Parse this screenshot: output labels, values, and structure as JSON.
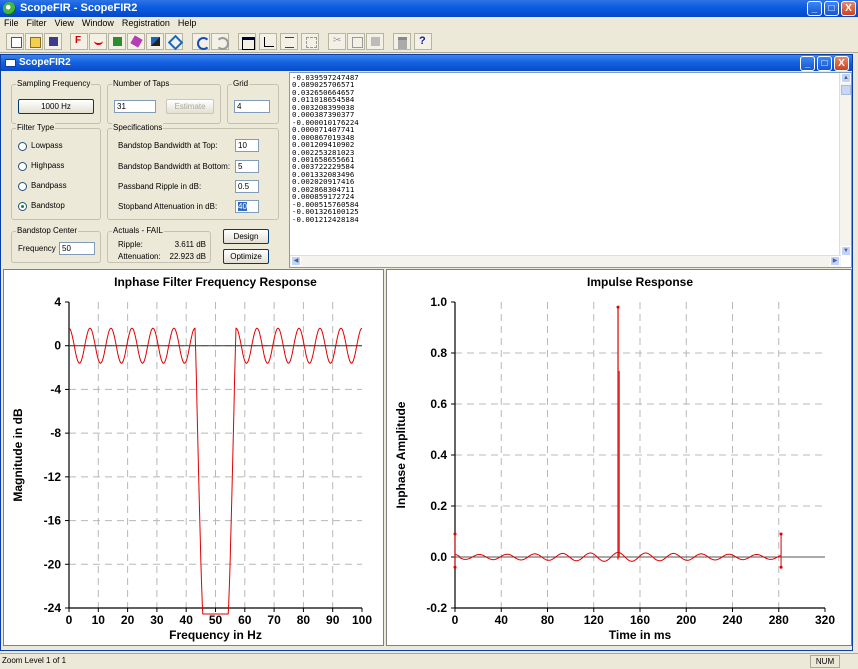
{
  "app": {
    "title": "ScopeFIR - ScopeFIR2",
    "window_buttons": {
      "minimize": "_",
      "maximize": "□",
      "close": "X"
    }
  },
  "menu": [
    "File",
    "Filter",
    "View",
    "Window",
    "Registration",
    "Help"
  ],
  "toolbar_icons": [
    "new-file-icon",
    "open-folder-icon",
    "save-icon",
    "filter-f-icon",
    "waveform-icon",
    "calculator-icon",
    "eraser-icon",
    "chart-icon",
    "diamond-icon",
    "undo-icon",
    "redo-icon",
    "window-icon",
    "axes-icon",
    "response-line-icon",
    "grid-icon",
    "cut-icon",
    "copy-icon",
    "paste-icon",
    "print-icon",
    "help-icon"
  ],
  "child_window": {
    "title": "ScopeFIR2"
  },
  "sampling_frequency": {
    "label": "Sampling Frequency",
    "button": "1000 Hz"
  },
  "number_of_taps": {
    "label": "Number of Taps",
    "value": "31",
    "estimate_button": "Estimate"
  },
  "grid": {
    "label": "Grid",
    "value": "4"
  },
  "filter_type": {
    "label": "Filter Type",
    "options": [
      "Lowpass",
      "Highpass",
      "Bandpass",
      "Bandstop"
    ],
    "selected": "Bandstop"
  },
  "specifications": {
    "label": "Specifications",
    "top_bw_label": "Bandstop Bandwidth at Top:",
    "top_bw": "10",
    "bottom_bw_label": "Bandstop Bandwidth at Bottom:",
    "bottom_bw": "5",
    "ripple_label": "Passband Ripple in dB:",
    "ripple": "0.5",
    "atten_label": "Stopband Attenuation in dB:",
    "atten": "40"
  },
  "bandstop_center": {
    "label": "Bandstop Center",
    "freq_label": "Frequency",
    "freq": "50"
  },
  "actuals": {
    "label": "Actuals - FAIL",
    "ripple_label": "Ripple:",
    "ripple": "3.611 dB",
    "atten_label": "Attenuation:",
    "atten": "22.923 dB"
  },
  "buttons": {
    "design": "Design",
    "optimize": "Optimize"
  },
  "coefficients": [
    "-0.039597247487",
    "0.089025706571",
    "0.032650664657",
    "0.011018654584",
    "0.003208399038",
    "0.000387390377",
    "-0.000010176224",
    "0.000071407741",
    "0.000867019348",
    "0.001209410902",
    "0.002253281023",
    "0.001658655661",
    "0.003722229584",
    "0.001332083496",
    "0.002020917416",
    "0.002868304711",
    "0.000859172724",
    "-0.000515760584",
    "-0.001326100125",
    "-0.001212428184"
  ],
  "chart_data": [
    {
      "type": "line",
      "title": "Inphase Filter Frequency Response",
      "xlabel": "Frequency in Hz",
      "ylabel": "Magnitude in dB",
      "xlim": [
        0,
        100
      ],
      "ylim": [
        -24,
        4
      ],
      "xticks": [
        0,
        10,
        20,
        30,
        40,
        50,
        60,
        70,
        80,
        90,
        100
      ],
      "yticks": [
        4,
        0,
        -4,
        -8,
        -12,
        -16,
        -20,
        -24
      ],
      "grid": true,
      "ripple_amplitude_db": 1.6,
      "ripple_cycles_per_side": 6,
      "notch_hz": 50,
      "color": "#e00000"
    },
    {
      "type": "line",
      "title": "Impulse Response",
      "xlabel": "Time in ms",
      "ylabel": "Inphase Amplitude",
      "xlim": [
        0,
        320
      ],
      "ylim": [
        -0.2,
        1.0
      ],
      "xticks": [
        0,
        40,
        80,
        120,
        160,
        200,
        240,
        280,
        320
      ],
      "yticks": [
        1.0,
        0.8,
        0.6,
        0.4,
        0.2,
        0.0,
        -0.2
      ],
      "grid": true,
      "peak": {
        "x": 141,
        "y": 0.98
      },
      "secondary": {
        "x": 142,
        "y": 0.73
      },
      "start": {
        "x": 0,
        "y_high": 0.09,
        "y_low": -0.04
      },
      "end": {
        "x": 282,
        "y_high": 0.09,
        "y_low": -0.04
      },
      "color": "#e00000"
    }
  ],
  "status": {
    "text": "Zoom Level 1 of 1",
    "num": "NUM"
  }
}
